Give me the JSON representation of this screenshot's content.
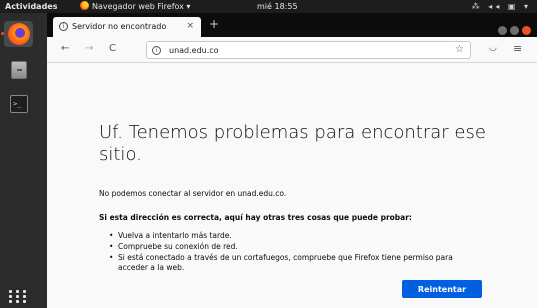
{
  "topbar": {
    "activities": "Actividades",
    "app_name": "Navegador web Firefox ▾",
    "clock": "mié 18:55",
    "tray": "⁂ ◂◂ ▣ ▾"
  },
  "dock": {
    "items": [
      "firefox",
      "files",
      "terminal",
      "show-applications"
    ],
    "terminal_glyph": ">_"
  },
  "tab": {
    "title": "Servidor no encontrado",
    "close": "×",
    "new_tab": "+"
  },
  "navbar": {
    "back": "←",
    "forward": "→",
    "reload": "C",
    "url": "unad.edu.co",
    "star": "☆",
    "pocket": "◡",
    "menu": "≡"
  },
  "error_page": {
    "title": "Uf. Tenemos problemas para encontrar ese sitio.",
    "description": "No podemos conectar al servidor en unad.edu.co.",
    "subtitle": "Si esta dirección es correcta, aquí hay otras tres cosas que puede probar:",
    "tips": [
      "Vuelva a intentarlo más tarde.",
      "Compruebe su conexión de red.",
      "Si está conectado a través de un cortafuegos, compruebe que Firefox tiene permiso para acceder a la web."
    ],
    "retry_label": "Reintentar"
  },
  "colors": {
    "accent": "#0060df",
    "ubuntu_orange": "#e95420"
  }
}
